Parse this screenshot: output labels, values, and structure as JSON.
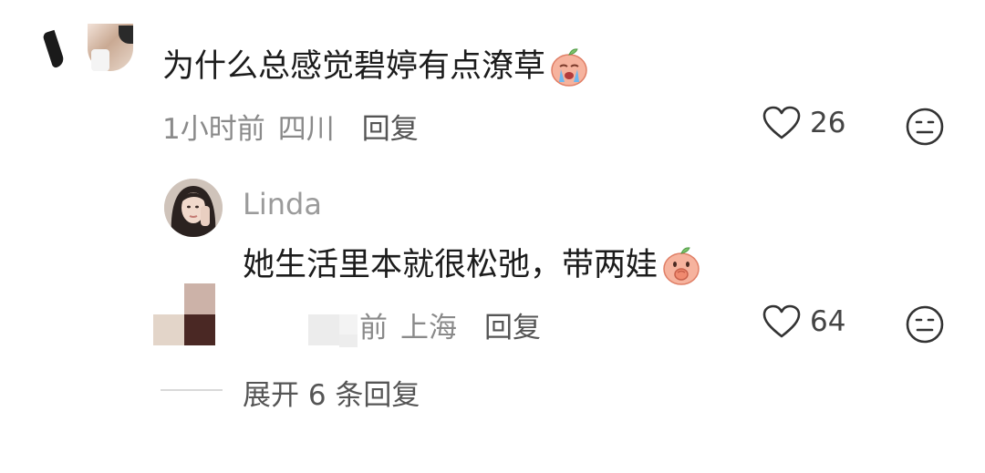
{
  "top_remnant": "&#8230;",
  "comment": {
    "text": "为什么总感觉碧婷有点潦草",
    "emoji": "crying-face-emoji",
    "time": "1小时前",
    "location": "四川",
    "reply_label": "回复",
    "likes": "26"
  },
  "reply": {
    "author": "Linda",
    "text": "她生活里本就很松弛，带两娃",
    "emoji": "covering-mouth-face-emoji",
    "time_partial": "前",
    "location": "上海",
    "reply_label": "回复",
    "likes": "64"
  },
  "expand": {
    "label": "展开 6 条回复"
  },
  "colors": {
    "text_primary": "#1c1c1c",
    "text_meta": "#8a8a8a",
    "text_action": "#555555",
    "emoji_peach": "#f4a48c"
  }
}
